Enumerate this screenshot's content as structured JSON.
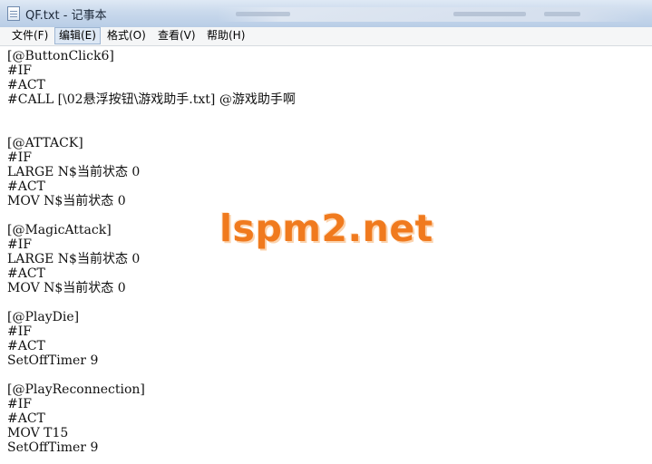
{
  "window": {
    "title": "QF.txt - 记事本",
    "icon": "notepad-icon"
  },
  "menu": {
    "items": [
      {
        "label": "文件(F)"
      },
      {
        "label": "编辑(E)"
      },
      {
        "label": "格式(O)"
      },
      {
        "label": "查看(V)"
      },
      {
        "label": "帮助(H)"
      }
    ],
    "active_item": "编辑(E)"
  },
  "document": {
    "lines": [
      "[@ButtonClick6]",
      "#IF",
      "#ACT",
      "#CALL [\\02悬浮按钮\\游戏助手.txt] @游戏助手啊",
      "",
      "",
      "[@ATTACK]",
      "#IF",
      "LARGE N$当前状态 0",
      "#ACT",
      "MOV N$当前状态 0",
      "",
      "[@MagicAttack]",
      "#IF",
      "LARGE N$当前状态 0",
      "#ACT",
      "MOV N$当前状态 0",
      "",
      "[@PlayDie]",
      "#IF",
      "#ACT",
      "SetOffTimer 9",
      "",
      "[@PlayReconnection]",
      "#IF",
      "#ACT",
      "MOV T15",
      "SetOffTimer 9"
    ]
  },
  "watermark": {
    "text": "lspm2.net",
    "color": "#f07a1e"
  }
}
